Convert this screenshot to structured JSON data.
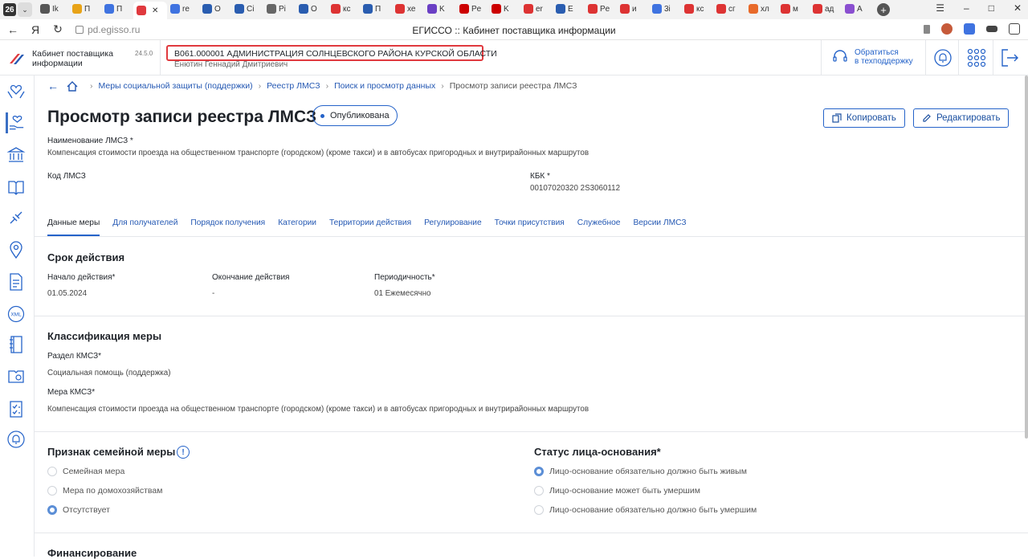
{
  "browser": {
    "tab_count": "26",
    "tabs": [
      "Ik",
      "П",
      "П",
      "",
      "re",
      "O",
      "Ci",
      "Pi",
      "O",
      "кс",
      "П",
      "хе",
      "K",
      "Pe",
      "K",
      "er",
      "E",
      "Pe",
      "и",
      "3i",
      "кс",
      "сг",
      "хл",
      "м",
      "ад",
      "A"
    ],
    "active_tab_index": 3,
    "url": "pd.egisso.ru",
    "page_title": "ЕГИССО :: Кабинет поставщика информации"
  },
  "header": {
    "brand_line1": "Кабинет поставщика",
    "brand_line2": "информации",
    "version": "24.5.0",
    "organization": "В061.000001 АДМИНИСТРАЦИЯ СОЛНЦЕВСКОГО РАЙОНА КУРСКОЙ ОБЛАСТИ",
    "user": "Енютин Геннадий Дмитриевич",
    "support_line1": "Обратиться",
    "support_line2": "в техподдержку"
  },
  "breadcrumbs": [
    "Меры социальной защиты (поддержки)",
    "Реестр ЛМСЗ",
    "Поиск и просмотр данных",
    "Просмотр записи реестра ЛМСЗ"
  ],
  "page": {
    "title": "Просмотр записи реестра ЛМСЗ",
    "status": "Опубликована",
    "copy_label": "Копировать",
    "edit_label": "Редактировать"
  },
  "fields": {
    "name_label": "Наименование ЛМСЗ *",
    "name_value": "Компенсация стоимости проезда на общественном транспорте (городском) (кроме такси) и в автобусах пригородных и внутрирайонных маршрутов",
    "code_label": "Код ЛМСЗ",
    "kbk_label": "КБК *",
    "kbk_value": "00107020320 2S3060112"
  },
  "tabs": [
    "Данные меры",
    "Для получателей",
    "Порядок получения",
    "Категории",
    "Территории действия",
    "Регулирование",
    "Точки присутствия",
    "Служебное",
    "Версии ЛМСЗ"
  ],
  "validity": {
    "title": "Срок действия",
    "start_label": "Начало действия*",
    "start_value": "01.05.2024",
    "end_label": "Окончание действия",
    "end_value": "-",
    "period_label": "Периодичность*",
    "period_value": "01 Ежемесячно"
  },
  "classification": {
    "title": "Классификация меры",
    "section_label": "Раздел КМСЗ*",
    "section_value": "Социальная помощь (поддержка)",
    "measure_label": "Мера КМСЗ*",
    "measure_value": "Компенсация стоимости проезда на общественном транспорте (городском) (кроме такси) и в автобусах пригородных и внутрирайонных маршрутов"
  },
  "family": {
    "title": "Признак семейной меры",
    "info_icon": "!",
    "options": [
      "Семейная мера",
      "Мера по домохозяйствам",
      "Отсутствует"
    ],
    "selected": 2
  },
  "person_status": {
    "title": "Статус лица-основания*",
    "options": [
      "Лицо-основание обязательно должно быть живым",
      "Лицо-основание может быть умершим",
      "Лицо-основание обязательно должно быть умершим"
    ],
    "selected": 0
  },
  "financing": {
    "title": "Финансирование"
  },
  "colors": {
    "accent": "#2563c9",
    "highlight": "#e0393e"
  }
}
